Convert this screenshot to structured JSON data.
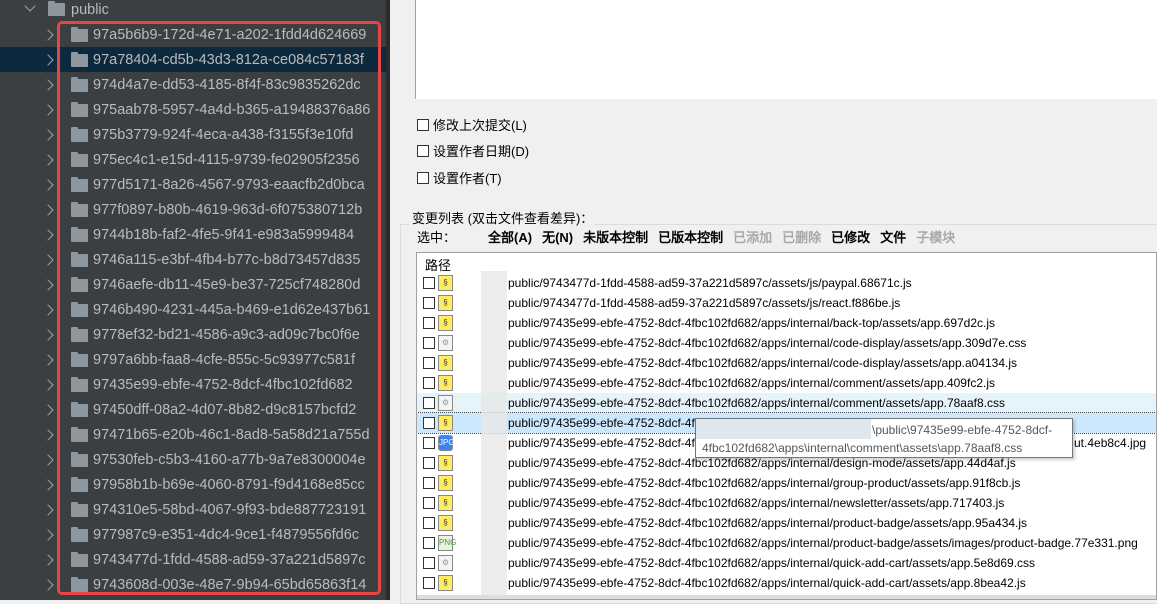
{
  "tree": {
    "parent": "public",
    "selected_index": 1,
    "folders": [
      "97a5b6b9-172d-4e71-a202-1fdd4d624669",
      "97a78404-cd5b-43d3-812a-ce084c57183f",
      "974d4a7e-dd53-4185-8f4f-83c9835262dc",
      "975aab78-5957-4a4d-b365-a19488376a86",
      "975b3779-924f-4eca-a438-f3155f3e10fd",
      "975ec4c1-e15d-4115-9739-fe02905f2356",
      "977d5171-8a26-4567-9793-eaacfb2d0bca",
      "977f0897-b80b-4619-963d-6f075380712b",
      "9744b18b-faf2-4fe5-9f41-e983a5999484",
      "9746a115-e3bf-4fb4-b77c-b8d73457d835",
      "9746aefe-db11-45e9-be37-725cf748280d",
      "9746b490-4231-445a-b469-e1d62e437b61",
      "9778ef32-bd21-4586-a9c3-ad09c7bc0f6e",
      "9797a6bb-faa8-4cfe-855c-5c93977c581f",
      "97435e99-ebfe-4752-8dcf-4fbc102fd682",
      "97450dff-08a2-4d07-8b82-d9c8157bcfd2",
      "97471b65-e20b-46c1-8ad8-5a58d21a755d",
      "97530feb-c5b3-4160-a77b-9a7e8300004e",
      "97958b1b-b69e-4060-8791-f9d4168e85cc",
      "974310e5-58bd-4067-9f93-bde887723191",
      "977987c9-e351-4dc4-9ce1-f4879556fd6c",
      "9743477d-1fdd-4588-ad59-37a221d5897c",
      "9743608d-003e-48e7-9b94-65bd65863f14"
    ]
  },
  "commit": {
    "options": [
      "修改上次提交(L)",
      "设置作者日期(D)",
      "设置作者(T)"
    ],
    "changes_label": "变更列表 (双击文件查看差异)：",
    "select_label": "选中：",
    "select_filters": [
      {
        "label": "全部(A)",
        "enabled": true
      },
      {
        "label": "无(N)",
        "enabled": true
      },
      {
        "label": "未版本控制",
        "enabled": true
      },
      {
        "label": "已版本控制",
        "enabled": true
      },
      {
        "label": "已添加",
        "enabled": false
      },
      {
        "label": "已删除",
        "enabled": false
      },
      {
        "label": "已修改",
        "enabled": true
      },
      {
        "label": "文件",
        "enabled": true
      },
      {
        "label": "子模块",
        "enabled": false
      }
    ],
    "column_header": "路径",
    "files": [
      {
        "type": "js",
        "path": "public/9743477d-1fdd-4588-ad59-37a221d5897c/assets/js/paypal.68671c.js"
      },
      {
        "type": "js",
        "path": "public/9743477d-1fdd-4588-ad59-37a221d5897c/assets/js/react.f886be.js"
      },
      {
        "type": "js",
        "path": "public/97435e99-ebfe-4752-8dcf-4fbc102fd682/apps/internal/back-top/assets/app.697d2c.js"
      },
      {
        "type": "css",
        "path": "public/97435e99-ebfe-4752-8dcf-4fbc102fd682/apps/internal/code-display/assets/app.309d7e.css"
      },
      {
        "type": "js",
        "path": "public/97435e99-ebfe-4752-8dcf-4fbc102fd682/apps/internal/code-display/assets/app.a04134.js"
      },
      {
        "type": "js",
        "path": "public/97435e99-ebfe-4752-8dcf-4fbc102fd682/apps/internal/comment/assets/app.409fc2.js"
      },
      {
        "type": "css",
        "path": "public/97435e99-ebfe-4752-8dcf-4fbc102fd682/apps/internal/comment/assets/app.78aaf8.css"
      },
      {
        "type": "js",
        "path": "public/97435e99-ebfe-4752-8dcf-4fb"
      },
      {
        "type": "jpg",
        "path": "public/97435e99-ebfe-4752-8dcf-4fb",
        "tail": "ut.4eb8c4.jpg"
      },
      {
        "type": "js",
        "path": "public/97435e99-ebfe-4752-8dcf-4fbc102fd682/apps/internal/design-mode/assets/app.44d4af.js"
      },
      {
        "type": "js",
        "path": "public/97435e99-ebfe-4752-8dcf-4fbc102fd682/apps/internal/group-product/assets/app.91f8cb.js"
      },
      {
        "type": "js",
        "path": "public/97435e99-ebfe-4752-8dcf-4fbc102fd682/apps/internal/newsletter/assets/app.717403.js"
      },
      {
        "type": "js",
        "path": "public/97435e99-ebfe-4752-8dcf-4fbc102fd682/apps/internal/product-badge/assets/app.95a434.js"
      },
      {
        "type": "png",
        "path": "public/97435e99-ebfe-4752-8dcf-4fbc102fd682/apps/internal/product-badge/assets/images/product-badge.77e331.png"
      },
      {
        "type": "css",
        "path": "public/97435e99-ebfe-4752-8dcf-4fbc102fd682/apps/internal/quick-add-cart/assets/app.5e8d69.css"
      },
      {
        "type": "js",
        "path": "public/97435e99-ebfe-4752-8dcf-4fbc102fd682/apps/internal/quick-add-cart/assets/app.8bea42.js"
      }
    ],
    "tooltip": [
      "\\public\\97435e99-ebfe-4752-8dcf-",
      "4fbc102fd682\\apps\\internal\\comment\\assets\\app.78aaf8.css"
    ]
  }
}
